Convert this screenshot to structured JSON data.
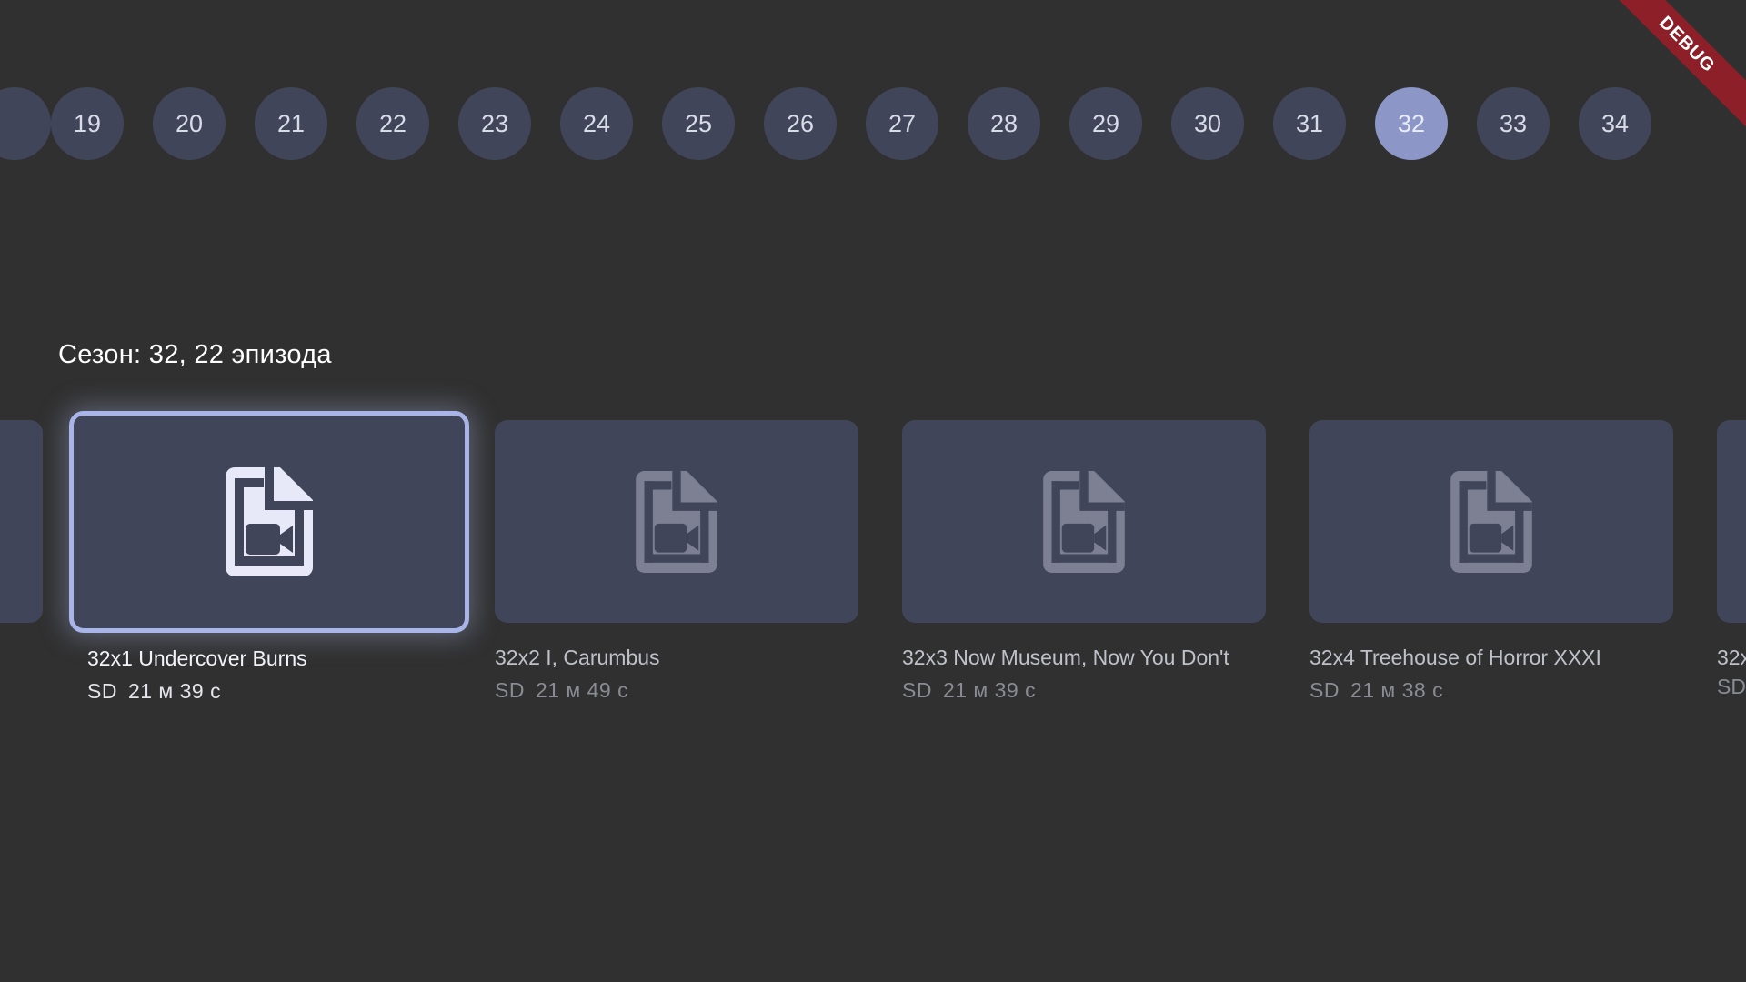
{
  "seasons": {
    "items": [
      "19",
      "20",
      "21",
      "22",
      "23",
      "24",
      "25",
      "26",
      "27",
      "28",
      "29",
      "30",
      "31",
      "32",
      "33",
      "34"
    ],
    "selected": "32"
  },
  "debug_label": "DEBUG",
  "season_heading": "Сезон: 32, 22 эпизода",
  "episodes": [
    {
      "title": "32x1 Undercover Burns",
      "quality": "SD",
      "duration": "21 м 39 с"
    },
    {
      "title": "32x2 I, Carumbus",
      "quality": "SD",
      "duration": "21 м 49 с"
    },
    {
      "title": "32x3 Now Museum, Now You Don't",
      "quality": "SD",
      "duration": "21 м 39 с"
    },
    {
      "title": "32x4 Treehouse of Horror XXXI",
      "quality": "SD",
      "duration": "21 м 38 с"
    }
  ],
  "next_episode_partial": {
    "title": "32x",
    "quality": "SD"
  },
  "icons": {
    "episode_thumb": "video-file-icon"
  },
  "colors": {
    "background": "#303030",
    "pill": "#414559",
    "pill_selected": "#8c97c8",
    "focus_border": "#a9b4e8",
    "debug_ribbon": "#8c1f28"
  }
}
